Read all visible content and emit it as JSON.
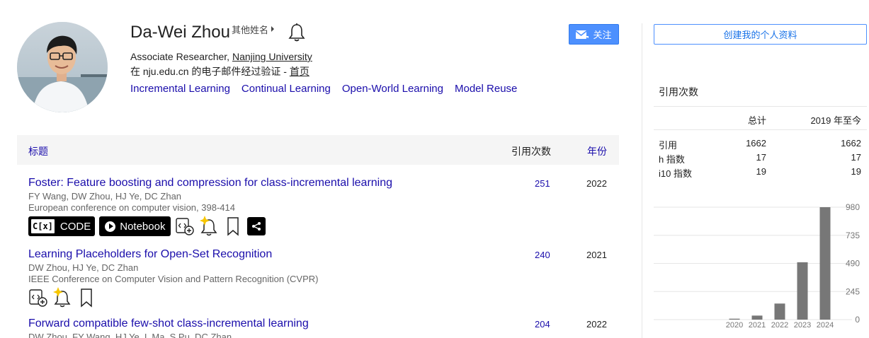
{
  "profile": {
    "name": "Da-Wei Zhou",
    "other_names": "其他姓名",
    "affiliation_prefix": "Associate Researcher, ",
    "affiliation_org": "Nanjing University",
    "verified_text": "在 nju.edu.cn 的电子邮件经过验证 - ",
    "homepage": "首页",
    "interests": [
      "Incremental Learning",
      "Continual Learning",
      "Open-World Learning",
      "Model Reuse"
    ],
    "follow_label": "关注"
  },
  "table": {
    "col_title": "标题",
    "col_cited": "引用次数",
    "col_year": "年份"
  },
  "toolbar": {
    "code_icon_text": "C[x]",
    "code_label": "CODE",
    "notebook_label": "Notebook"
  },
  "publications": [
    {
      "title": "Foster: Feature boosting and compression for class-incremental learning",
      "authors": "FY Wang, DW Zhou, HJ Ye, DC Zhan",
      "venue": "European conference on computer vision, 398-414",
      "cited": "251",
      "year": "2022"
    },
    {
      "title": "Learning Placeholders for Open-Set Recognition",
      "authors": "DW Zhou, HJ Ye, DC Zhan",
      "venue": "IEEE Conference on Computer Vision and Pattern Recognition (CVPR)",
      "cited": "240",
      "year": "2021"
    },
    {
      "title": "Forward compatible few-shot class-incremental learning",
      "authors": "DW Zhou, FY Wang, HJ Ye, L Ma, S Pu, DC Zhan",
      "venue": "",
      "cited": "204",
      "year": "2022"
    }
  ],
  "sidebar": {
    "create_profile": "创建我的个人资料",
    "cited_by": "引用次数",
    "col_all": "总计",
    "col_since": "2019 年至今",
    "metrics": [
      {
        "label": "引用",
        "all": "1662",
        "since": "1662"
      },
      {
        "label": "h 指数",
        "all": "17",
        "since": "17"
      },
      {
        "label": "i10 指数",
        "all": "19",
        "since": "19"
      }
    ]
  },
  "chart_data": {
    "type": "bar",
    "categories": [
      "2020",
      "2021",
      "2022",
      "2023",
      "2024"
    ],
    "values": [
      8,
      35,
      140,
      500,
      980
    ],
    "yticks": [
      "980",
      "735",
      "490",
      "245",
      "0"
    ],
    "ytick_values": [
      980,
      735,
      490,
      245,
      0
    ],
    "ylim": [
      0,
      980
    ],
    "bar_color": "#777777",
    "grid": true
  },
  "colors": {
    "link": "#1a0dab",
    "accent": "#4d90fe"
  }
}
